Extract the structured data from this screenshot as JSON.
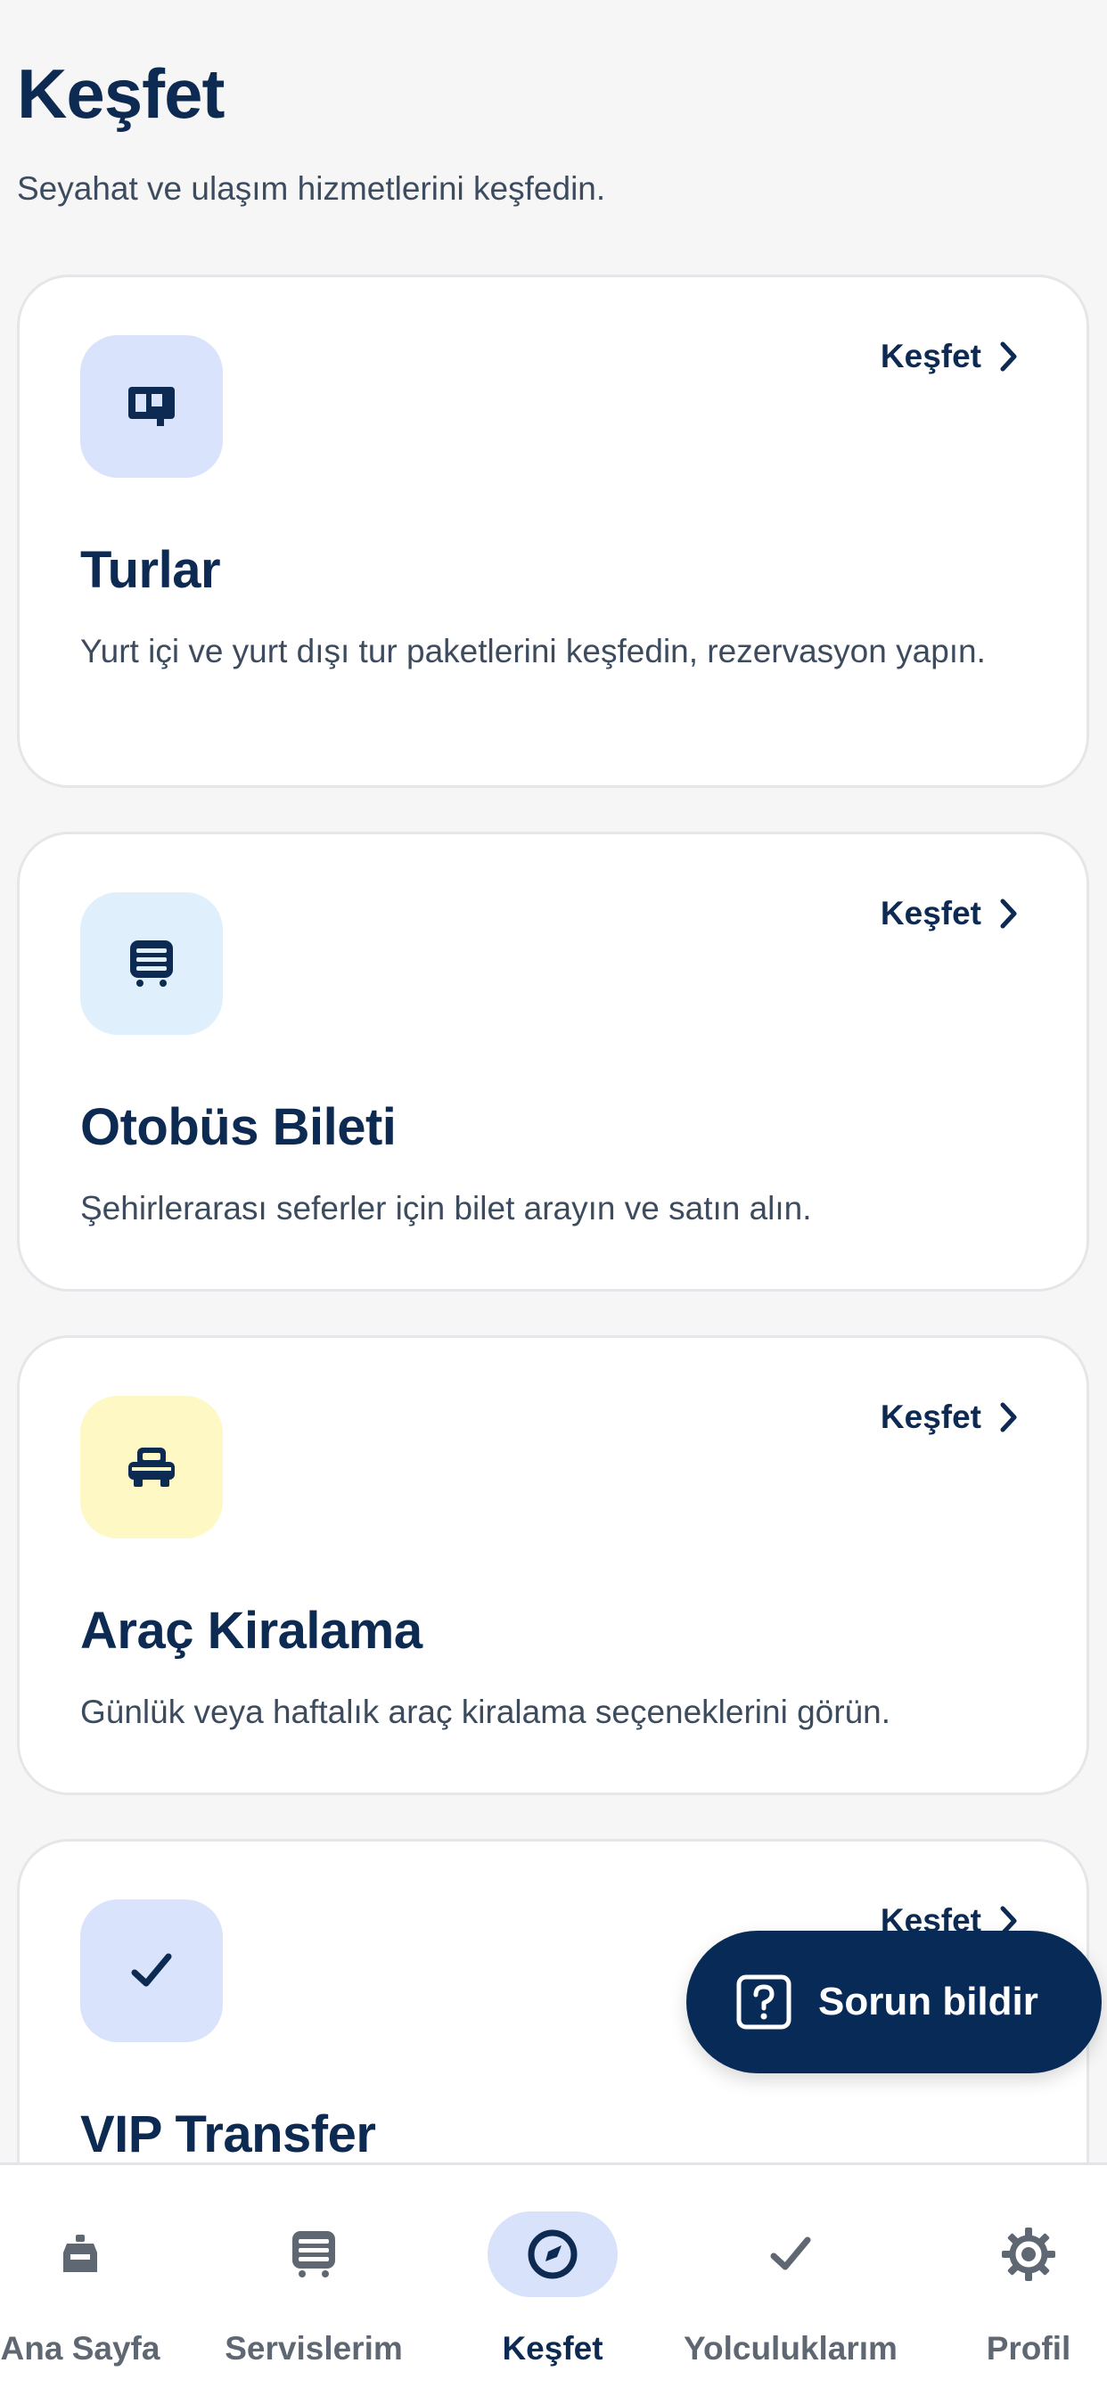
{
  "header": {
    "title": "Keşfet",
    "subtitle": "Seyahat ve ulaşım hizmetlerini keşfedin."
  },
  "cards": [
    {
      "title": "Turlar",
      "description": "Yurt içi ve yurt dışı tur paketlerini keşfedin, rezervasyon yapın.",
      "link_label": "Keşfet",
      "icon": "tour-map-icon",
      "icon_bg": "#d9e3fc"
    },
    {
      "title": "Otobüs Bileti",
      "description": "Şehirlerarası seferler için bilet arayın ve satın alın.",
      "link_label": "Keşfet",
      "icon": "bus-icon",
      "icon_bg": "#dff0fc"
    },
    {
      "title": "Araç Kiralama",
      "description": "Günlük veya haftalık araç kiralama seçeneklerini görün.",
      "link_label": "Keşfet",
      "icon": "car-icon",
      "icon_bg": "#fdf8c4"
    },
    {
      "title": "VIP Transfer",
      "description": "",
      "link_label": "Keşfet",
      "icon": "check-icon",
      "icon_bg": "#d9e3fc"
    }
  ],
  "fab": {
    "label": "Sorun bildir",
    "icon": "question-icon"
  },
  "tabs": [
    {
      "label": "Ana Sayfa",
      "icon": "home-icon",
      "active": false
    },
    {
      "label": "Servislerim",
      "icon": "bus-icon",
      "active": false
    },
    {
      "label": "Keşfet",
      "icon": "compass-icon",
      "active": true
    },
    {
      "label": "Yolculuklarım",
      "icon": "check-icon",
      "active": false
    },
    {
      "label": "Profil",
      "icon": "gear-icon",
      "active": false
    }
  ],
  "colors": {
    "primary": "#0d2a52",
    "fab_background": "#082a57",
    "active_tab_pill": "#d9e2fb",
    "page_background": "#f7f6f6"
  }
}
